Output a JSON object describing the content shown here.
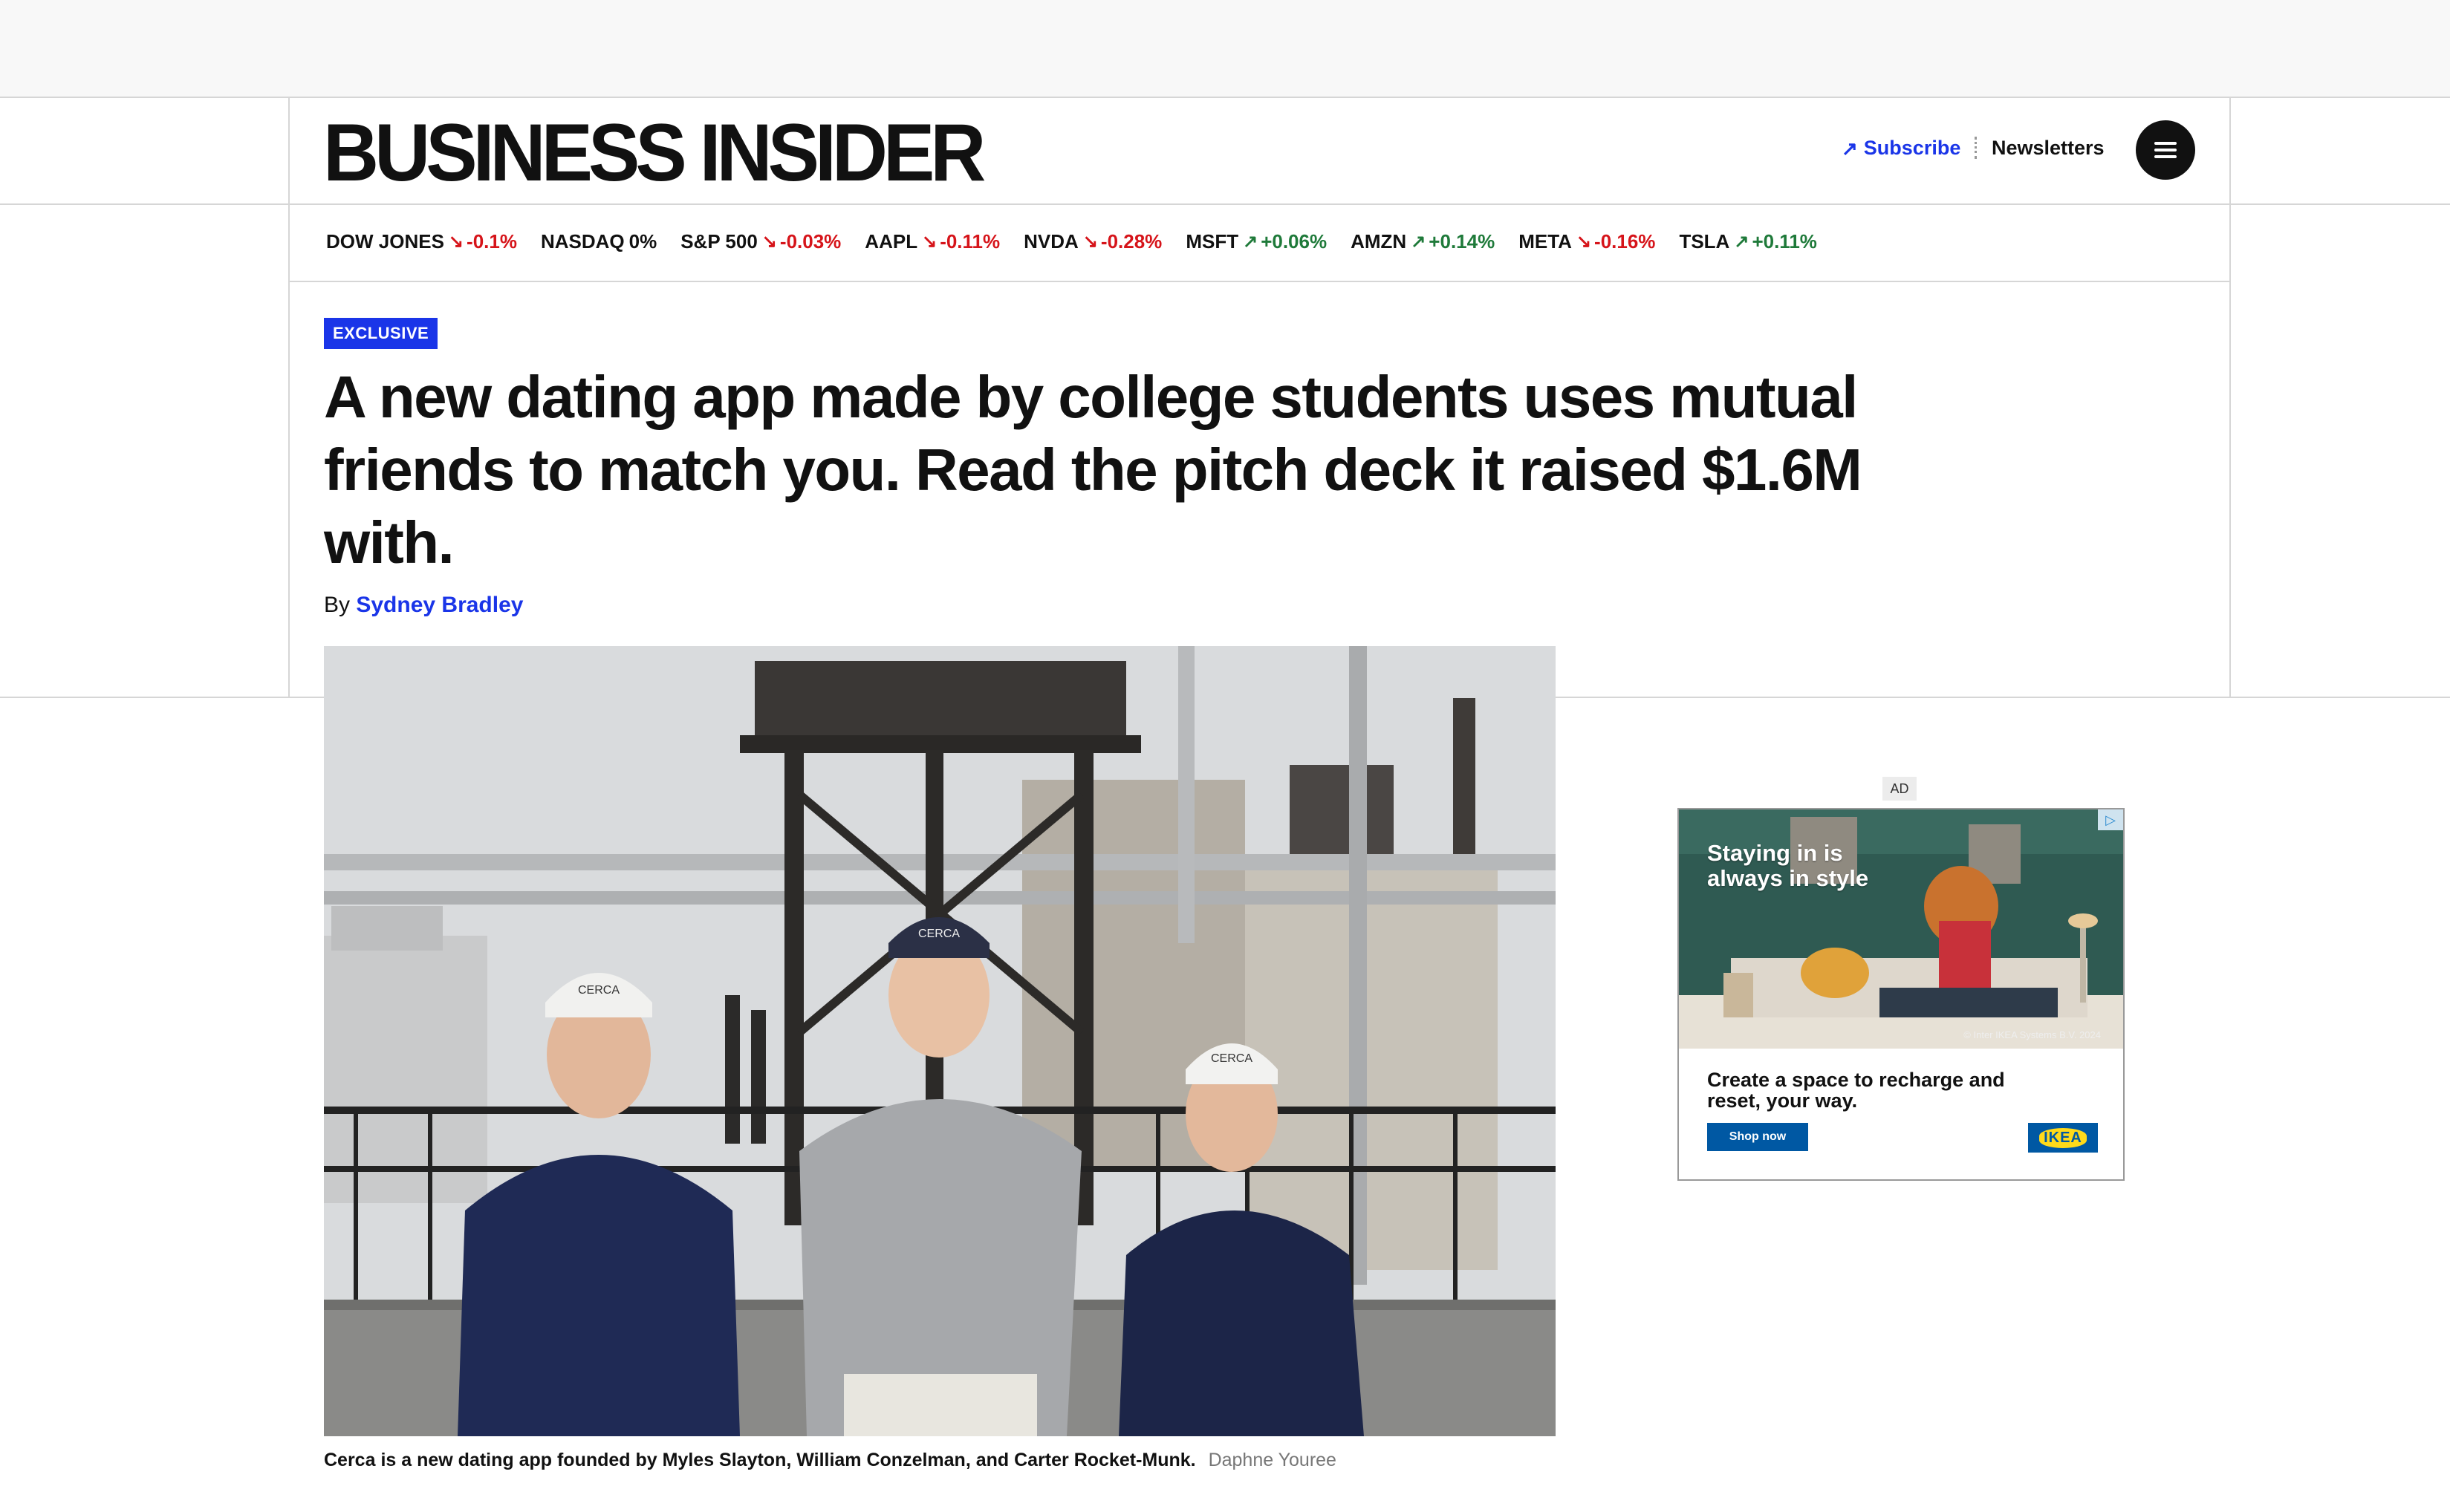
{
  "brand": {
    "logo_text": "BUSINESS INSIDER",
    "accent_color": "#1a35e8"
  },
  "header": {
    "subscribe_label": "Subscribe",
    "subscribe_icon": "arrow-up-right-icon",
    "newsletters_label": "Newsletters",
    "menu_icon": "hamburger-menu-icon"
  },
  "ticker": [
    {
      "symbol": "DOW JONES",
      "direction": "down",
      "change": "-0.1%"
    },
    {
      "symbol": "NASDAQ",
      "direction": "flat",
      "change": "0%"
    },
    {
      "symbol": "S&P 500",
      "direction": "down",
      "change": "-0.03%"
    },
    {
      "symbol": "AAPL",
      "direction": "down",
      "change": "-0.11%"
    },
    {
      "symbol": "NVDA",
      "direction": "down",
      "change": "-0.28%"
    },
    {
      "symbol": "MSFT",
      "direction": "up",
      "change": "+0.06%"
    },
    {
      "symbol": "AMZN",
      "direction": "up",
      "change": "+0.14%"
    },
    {
      "symbol": "META",
      "direction": "down",
      "change": "-0.16%"
    },
    {
      "symbol": "TSLA",
      "direction": "up",
      "change": "+0.11%"
    }
  ],
  "colors": {
    "down": "#d6141a",
    "up": "#1f7a3a"
  },
  "article": {
    "badge": "EXCLUSIVE",
    "headline": "A new dating app made by college students uses mutual friends to match you. Read the pitch deck it raised $1.6M with.",
    "byline_prefix": "By",
    "author": "Sydney Bradley",
    "image_caption": "Cerca is a new dating app founded by Myles Slayton, William Conzelman, and Carter Rocket-Munk.",
    "image_credit": "Daphne Youree",
    "cap_text": "CERCA"
  },
  "ad": {
    "label": "AD",
    "image_text_line1": "Staying in is",
    "image_text_line2": "always in style",
    "copyright": "© Inter IKEA Systems B.V. 2024",
    "tagline": "Create a space to recharge and reset, your way.",
    "cta_label": "Shop now",
    "logo_text": "IKEA",
    "info_icon": "ad-choices-icon"
  }
}
